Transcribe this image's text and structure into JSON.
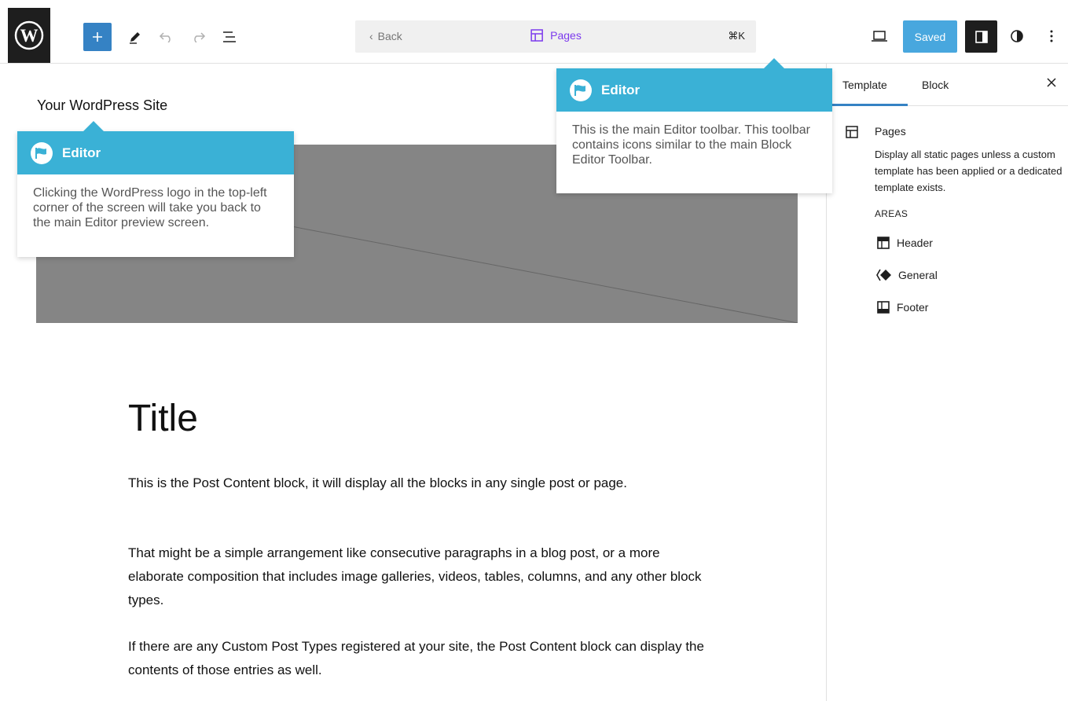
{
  "toolbar": {
    "logo_icon": "wordpress-logo",
    "inserter_icon": "plus-icon",
    "tools_icon": "pencil-icon",
    "undo_icon": "undo-icon",
    "redo_icon": "redo-icon",
    "list_view_icon": "list-view-icon",
    "back_label": "Back",
    "command_label": "Pages",
    "shortcut": "⌘K",
    "device_icon": "laptop-icon",
    "saved_label": "Saved",
    "settings_icon": "sidebar-toggle-icon",
    "styles_icon": "half-circle-icon",
    "more_icon": "more-vertical-icon",
    "accent_color": "#3582c4",
    "command_color": "#7c3aed"
  },
  "canvas": {
    "site_title": "Your WordPress Site",
    "hero_color": "#858585",
    "post_title": "Title",
    "paragraphs": [
      "This is the Post Content block, it will display all the blocks in any single post or page.",
      "That might be a simple arrangement like consecutive paragraphs in a blog post, or a more elaborate composition that includes image galleries, videos, tables, columns, and any other block types.",
      "If there are any Custom Post Types registered at your site, the Post Content block can display the contents of those entries as well."
    ]
  },
  "sidebar": {
    "tabs": [
      {
        "label": "Template",
        "active": true
      },
      {
        "label": "Block",
        "active": false
      }
    ],
    "close_icon": "close-icon",
    "template_title": "Pages",
    "template_description": "Display all static pages unless a custom template has been applied or a dedicated template exists.",
    "areas_heading": "AREAS",
    "areas": [
      {
        "label": "Header",
        "icon": "header-icon"
      },
      {
        "label": "General",
        "icon": "diamond-icon"
      },
      {
        "label": "Footer",
        "icon": "footer-icon"
      }
    ]
  },
  "popovers": [
    {
      "title": "Editor",
      "body": "Clicking the WordPress logo in the top-left corner of the screen will take you back to the main Editor preview screen.",
      "header_color": "#3ab1d6"
    },
    {
      "title": "Editor",
      "body": "This is the main Editor toolbar. This toolbar contains icons similar to the main Block Editor Toolbar.",
      "header_color": "#3ab1d6"
    }
  ]
}
